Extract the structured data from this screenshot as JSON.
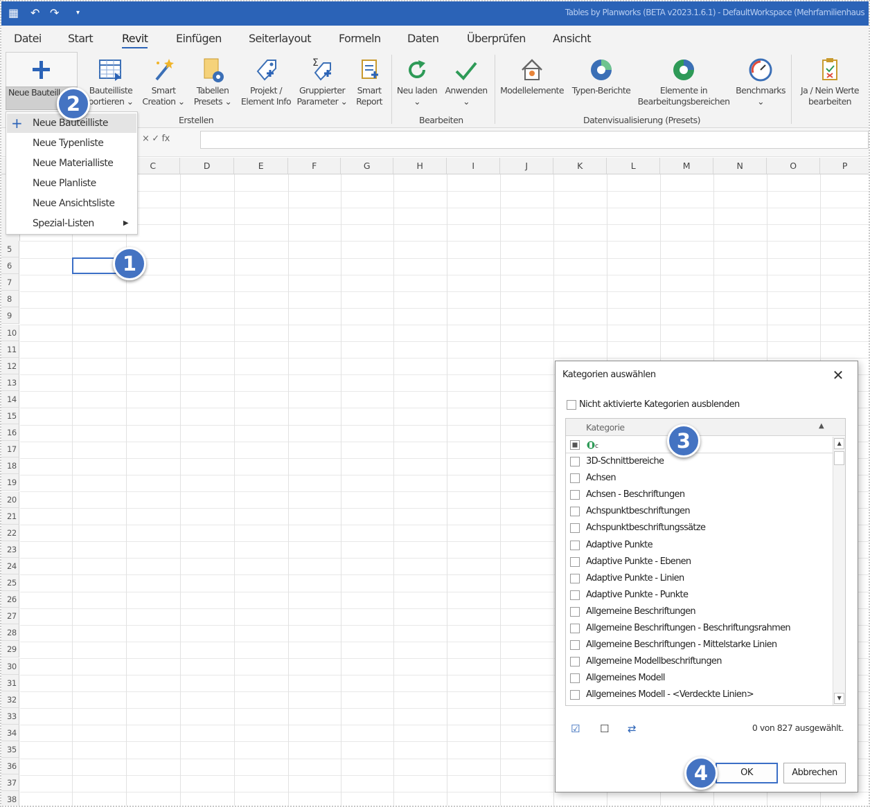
{
  "titlebar": {
    "title": "Tables by Planworks (BETA v2023.1.6.1) - DefaultWorkspace (Mehrfamilienhaus"
  },
  "menu": {
    "tabs": [
      "Datei",
      "Start",
      "Revit",
      "Einfügen",
      "Seiterlayout",
      "Formeln",
      "Daten",
      "Überprüfen",
      "Ansicht"
    ],
    "active": "Revit"
  },
  "ribbon": {
    "neue_label": "Neue Bauteill",
    "buttons": [
      {
        "l1": "Bauteilliste",
        "l2": "portieren ⌄"
      },
      {
        "l1": "Smart",
        "l2": "Creation ⌄"
      },
      {
        "l1": "Tabellen",
        "l2": "Presets ⌄"
      },
      {
        "l1": "Projekt /",
        "l2": "Element Info"
      },
      {
        "l1": "Gruppierter",
        "l2": "Parameter ⌄"
      },
      {
        "l1": "Smart",
        "l2": "Report"
      },
      {
        "l1": "Neu laden",
        "l2": "⌄"
      },
      {
        "l1": "Anwenden",
        "l2": "⌄"
      },
      {
        "l1": "Modellelemente",
        "l2": ""
      },
      {
        "l1": "Typen-Berichte",
        "l2": ""
      },
      {
        "l1": "Elemente in",
        "l2": "Bearbeitungsbereichen"
      },
      {
        "l1": "Benchmarks",
        "l2": "⌄"
      },
      {
        "l1": "Ja / Nein Werte",
        "l2": "bearbeiten"
      }
    ],
    "groups": [
      "Erstellen",
      "Bearbeiten",
      "Datenvisualisierung (Presets)"
    ]
  },
  "formula": {
    "icons": "×   ✓   fx"
  },
  "grid": {
    "columns": [
      "C",
      "D",
      "E",
      "F",
      "G",
      "H",
      "I",
      "J",
      "K",
      "L",
      "M",
      "N",
      "O",
      "P"
    ],
    "rows": [
      "5",
      "6",
      "7",
      "8",
      "9",
      "10",
      "11",
      "12",
      "13",
      "14",
      "15",
      "16",
      "17",
      "18",
      "19",
      "20",
      "21",
      "22",
      "23",
      "24",
      "25",
      "26",
      "27",
      "28",
      "29",
      "30",
      "31",
      "32",
      "33",
      "34",
      "35",
      "36",
      "37",
      "38"
    ]
  },
  "dropdown": {
    "items": [
      "Neue Bauteilliste",
      "Neue Typenliste",
      "Neue Materialliste",
      "Neue Planliste",
      "Neue Ansichtsliste",
      "Spezial-Listen"
    ]
  },
  "badges": [
    "1",
    "2",
    "3",
    "4"
  ],
  "dialog": {
    "title": "Kategorien auswählen",
    "hide_label": "Nicht aktivierte Kategorien ausblenden",
    "column_header": "Kategorie",
    "categories": [
      "3D-Schnittbereiche",
      "Achsen",
      "Achsen - Beschriftungen",
      "Achspunktbeschriftungen",
      "Achspunktbeschriftungssätze",
      "Adaptive Punkte",
      "Adaptive Punkte - Ebenen",
      "Adaptive Punkte - Linien",
      "Adaptive Punkte - Punkte",
      "Allgemeine Beschriftungen",
      "Allgemeine Beschriftungen - Beschriftungsrahmen",
      "Allgemeine Beschriftungen - Mittelstarke Linien",
      "Allgemeine Modellbeschriftungen",
      "Allgemeines Modell",
      "Allgemeines Modell - <Verdeckte Linien>"
    ],
    "selection_count": "0 von 827 ausgewählt.",
    "ok_label": "OK",
    "cancel_label": "Abbrechen"
  }
}
